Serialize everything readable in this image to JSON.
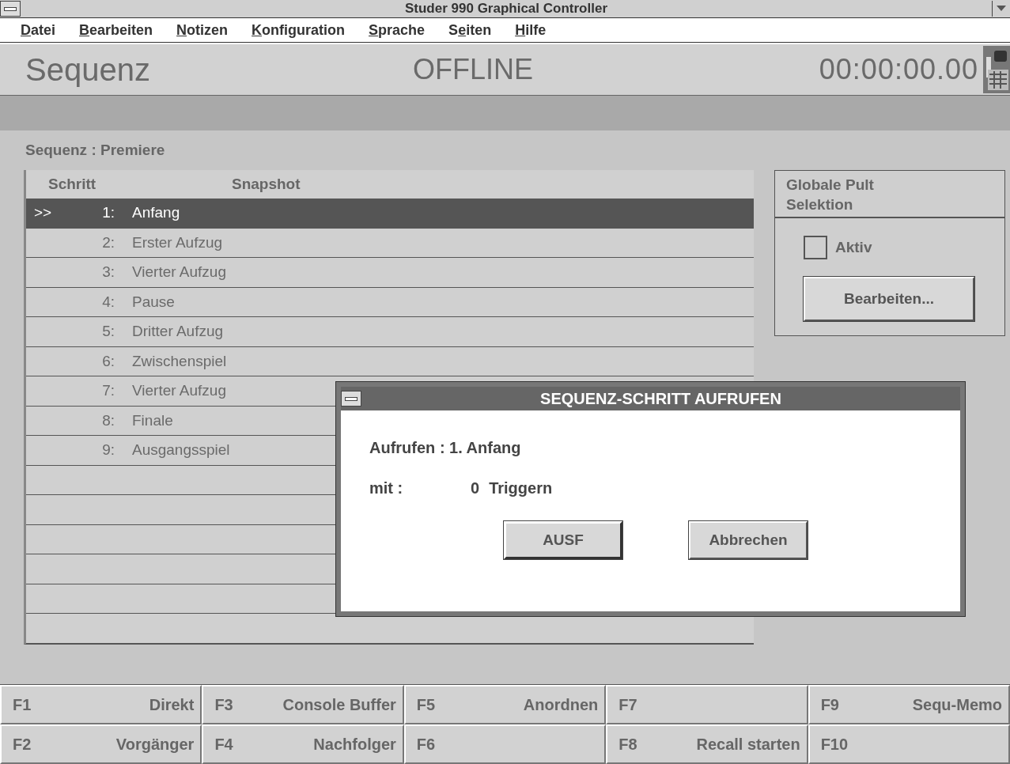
{
  "window": {
    "title": "Studer 990 Graphical Controller"
  },
  "menu": [
    {
      "key": "D",
      "post": "atei"
    },
    {
      "key": "B",
      "post": "earbeiten"
    },
    {
      "key": "N",
      "post": "otizen"
    },
    {
      "key": "K",
      "post": "onfiguration"
    },
    {
      "key": "S",
      "post": "prache"
    },
    {
      "pre": "S",
      "key": "e",
      "post": "iten"
    },
    {
      "key": "H",
      "post": "ilfe"
    }
  ],
  "header": {
    "page": "Sequenz",
    "status": "OFFLINE",
    "timecode": "00:00:00.00"
  },
  "sequence_label": "Sequenz : Premiere",
  "table": {
    "columns": [
      "Schritt",
      "Snapshot"
    ],
    "rows": [
      {
        "marker": ">>",
        "step": "1:",
        "snapshot": "Anfang",
        "selected": true
      },
      {
        "step": "2:",
        "snapshot": "Erster Aufzug",
        "selected": false
      },
      {
        "step": "3:",
        "snapshot": "Vierter Aufzug",
        "selected": false
      },
      {
        "step": "4:",
        "snapshot": "Pause",
        "selected": false
      },
      {
        "step": "5:",
        "snapshot": "Dritter Aufzug",
        "selected": false
      },
      {
        "step": "6:",
        "snapshot": "Zwischenspiel",
        "selected": false
      },
      {
        "step": "7:",
        "snapshot": "Vierter Aufzug",
        "selected": false
      },
      {
        "step": "8:",
        "snapshot": "Finale",
        "selected": false
      },
      {
        "step": "9:",
        "snapshot": "Ausgangsspiel",
        "selected": false
      }
    ]
  },
  "global_panel": {
    "title": "Globale Pult Selektion",
    "checkbox": {
      "label": "Aktiv",
      "checked": false
    },
    "button": "Bearbeiten..."
  },
  "dialog": {
    "title": "SEQUENZ-SCHRITT AUFRUFEN",
    "call_label": "Aufrufen : 1. Anfang",
    "with_label": "mit :",
    "trigger_count": "0",
    "trigger_label": "Triggern",
    "buttons": [
      {
        "label": "AUSF",
        "default": true
      },
      {
        "label": "Abbrechen",
        "default": false
      }
    ]
  },
  "function_keys": [
    [
      {
        "key": "F1",
        "label": "Direkt"
      },
      {
        "key": "F3",
        "label": "Console Buffer"
      },
      {
        "key": "F5",
        "label": "Anordnen"
      },
      {
        "key": "F7"
      },
      {
        "key": "F9",
        "label": "Sequ-Memo"
      }
    ],
    [
      {
        "key": "F2",
        "label": "Vorgänger"
      },
      {
        "key": "F4",
        "label": "Nachfolger"
      },
      {
        "key": "F6"
      },
      {
        "key": "F8",
        "label": "Recall starten"
      },
      {
        "key": "F10"
      }
    ]
  ]
}
